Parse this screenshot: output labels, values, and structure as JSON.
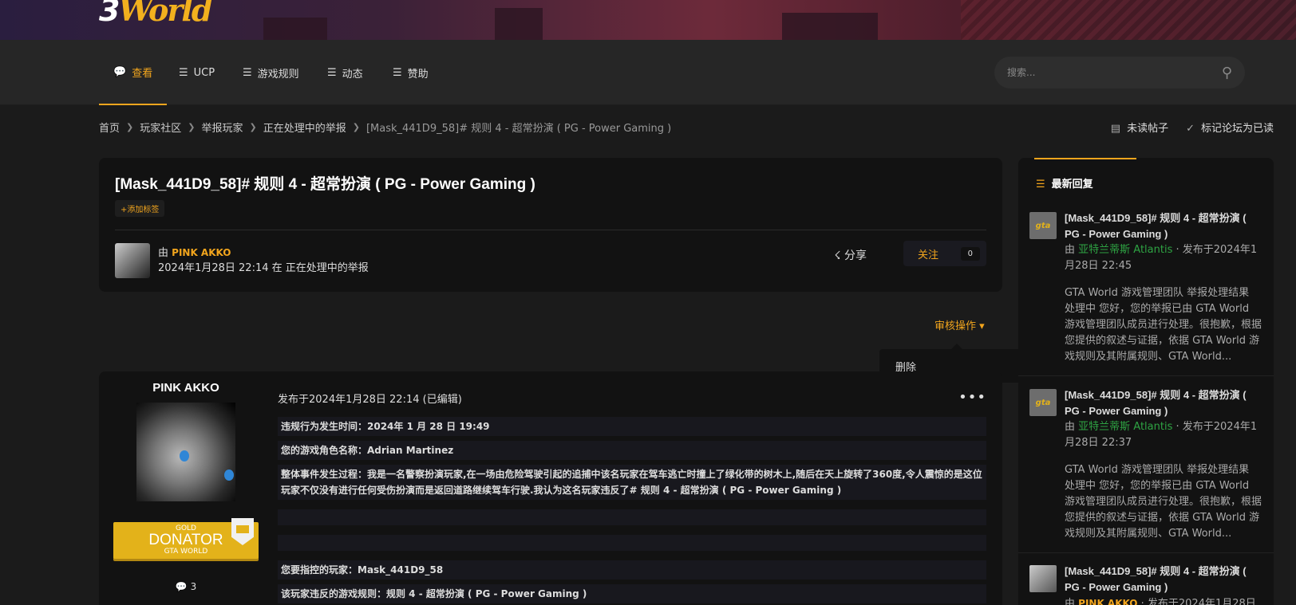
{
  "banner": {
    "logo_left": "3",
    "logo_right": "World"
  },
  "nav": {
    "items": [
      {
        "label": "查看",
        "icon": "chat-icon"
      },
      {
        "label": "UCP",
        "icon": "list-icon"
      },
      {
        "label": "游戏规则",
        "icon": "list-icon"
      },
      {
        "label": "动态",
        "icon": "stream-icon"
      },
      {
        "label": "赞助",
        "icon": "list-icon"
      }
    ],
    "search_placeholder": "搜索..."
  },
  "breadcrumb": {
    "items": [
      "首页",
      "玩家社区",
      "举报玩家",
      "正在处理中的举报"
    ],
    "current": "[Mask_441D9_58]# 规则 4 - 超常扮演 ( PG - Power Gaming )",
    "actions": [
      "未读帖子",
      "标记论坛为已读"
    ]
  },
  "topic": {
    "title": "[Mask_441D9_58]# 规则 4 - 超常扮演 ( PG - Power Gaming )",
    "add_tag": "添加标签",
    "by": "由",
    "author": "PINK AKKO",
    "meta": "2024年1月28日 22:14 在 正在处理中的举报",
    "share": "分享",
    "follow": "关注",
    "follow_count": "0"
  },
  "moderation": {
    "label": "审核操作",
    "menu_item": "删除"
  },
  "post": {
    "author": "PINK AKKO",
    "badge": {
      "top": "GOLD",
      "main": "DONATOR",
      "bottom": "GTA WORLD"
    },
    "post_count": "3",
    "date": "发布于2024年1月28日 22:14 (已编辑)",
    "lines": [
      "违规行为发生时间：2024年 1 月 28 日 19:49",
      "您的游戏角色名称：Adrian Martinez",
      "整体事件发生过程：我是一名警察扮演玩家,在一场由危险驾驶引起的追捕中该名玩家在驾车逃亡时撞上了绿化带的树木上,随后在天上旋转了360度,令人震惊的是这位玩家不仅没有进行任何受伤扮演而是返回道路继续驾车行驶.我认为这名玩家违反了# 规则 4 - 超常扮演 ( PG - Power Gaming )",
      "",
      "",
      "您要指控的玩家：Mask_441D9_58",
      "该玩家违反的游戏规则：规则 4 - 超常扮演 ( PG - Power Gaming )"
    ]
  },
  "sidebar": {
    "title": "最新回复",
    "items": [
      {
        "title": "[Mask_441D9_58]# 规则 4 - 超常扮演 ( PG - Power Gaming )",
        "by": "由",
        "user": "亚特兰蒂斯 Atlantis",
        "date": " · 发布于2024年1月28日 22:45",
        "excerpt": "GTA World 游戏管理团队 举报处理结果  处理中 您好，您的举报已由 GTA World 游戏管理团队成员进行处理。很抱歉，根据您提供的叙述与证据，依据 GTA World 游戏规则及其附属规则、GTA World..."
      },
      {
        "title": "[Mask_441D9_58]# 规则 4 - 超常扮演 ( PG - Power Gaming )",
        "by": "由",
        "user": "亚特兰蒂斯 Atlantis",
        "date": " · 发布于2024年1月28日 22:37",
        "excerpt": "GTA World 游戏管理团队 举报处理结果  处理中 您好，您的举报已由 GTA World 游戏管理团队成员进行处理。很抱歉，根据您提供的叙述与证据，依据 GTA World 游戏规则及其附属规则、GTA World..."
      },
      {
        "title": "[Mask_441D9_58]# 规则 4 - 超常扮演 ( PG - Power Gaming )",
        "by": "由",
        "user": "PINK AKKO",
        "date": " · 发布于2024年1月28日"
      }
    ]
  },
  "colors": {
    "accent": "#f2a51d",
    "green": "#2ea343",
    "panel": "#121212",
    "background": "#1b1b1b"
  }
}
